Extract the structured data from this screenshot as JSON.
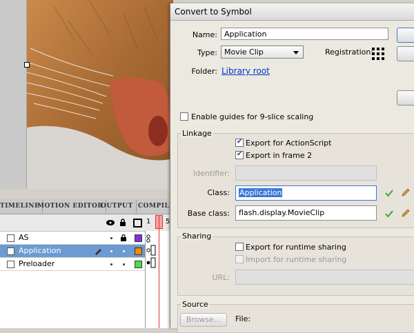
{
  "dialog": {
    "title": "Convert to Symbol",
    "name_label": "Name:",
    "name_value": "Application",
    "type_label": "Type:",
    "type_value": "Movie Clip",
    "registration_label": "Registration:",
    "folder_label": "Folder:",
    "folder_value": "Library root",
    "nine_slice_label": "Enable guides for 9-slice scaling",
    "linkage": {
      "title": "Linkage",
      "export_as_label": "Export for ActionScript",
      "export_frame_label": "Export in frame 2",
      "identifier_label": "Identifier:",
      "identifier_value": "",
      "class_label": "Class:",
      "class_value": "Application",
      "base_class_label": "Base class:",
      "base_class_value": "flash.display.MovieClip"
    },
    "sharing": {
      "title": "Sharing",
      "export_runtime_label": "Export for runtime sharing",
      "import_runtime_label": "Import for runtime sharing",
      "url_label": "URL:",
      "url_value": ""
    },
    "source": {
      "title": "Source",
      "browse_label": "Browse...",
      "file_label": "File:"
    },
    "checked": {
      "nine_slice": false,
      "export_as": true,
      "export_frame": true,
      "export_runtime": false,
      "import_runtime": false
    }
  },
  "timeline": {
    "tabs": [
      "TIMELINE",
      "MOTION EDITOR",
      "OUTPUT",
      "COMPILE"
    ],
    "frame_marker": "1",
    "frame_marker_right": "5",
    "layers": [
      {
        "name": "AS",
        "color": "#8a2be2",
        "selected": false
      },
      {
        "name": "Application",
        "color": "#f08a00",
        "selected": true
      },
      {
        "name": "Preloader",
        "color": "#4cdc4c",
        "selected": false
      }
    ]
  },
  "colors": {
    "accent": "#3a78d6",
    "link": "#0033cc",
    "selection_row": "#6b9bd1"
  }
}
